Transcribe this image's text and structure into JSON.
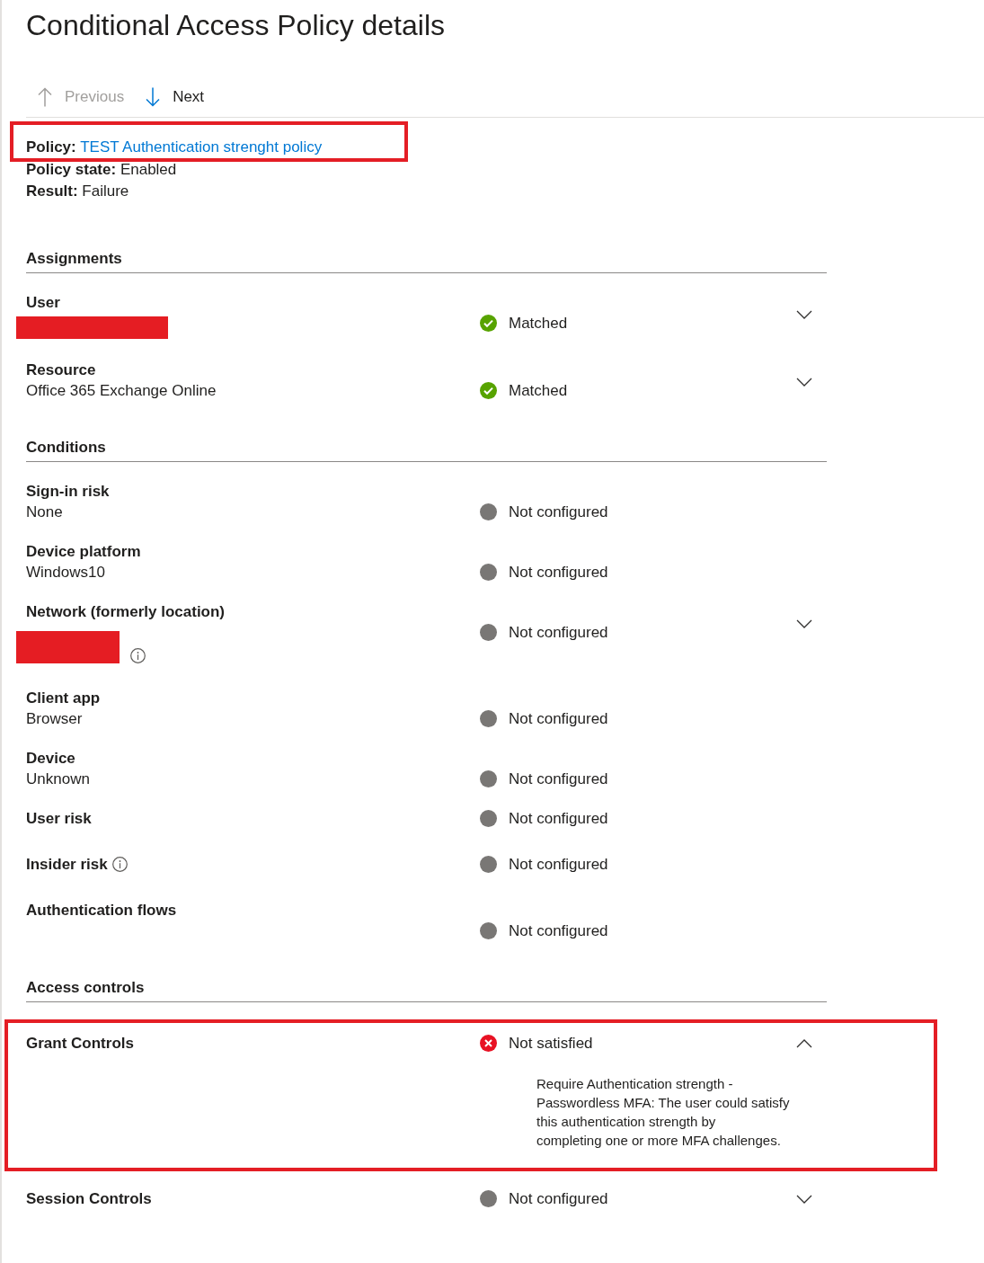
{
  "title": "Conditional Access Policy details",
  "navigation": [
    {
      "kind": "up",
      "label": "Previous",
      "disabled": true
    },
    {
      "kind": "down",
      "label": "Next",
      "disabled": false
    }
  ],
  "policy": [
    {
      "kind": "link",
      "label": "Policy:",
      "value": "TEST Authentication strenght policy",
      "highlighted": true
    },
    {
      "kind": "text",
      "label": "Policy state:",
      "value": "Enabled",
      "highlighted": false
    },
    {
      "kind": "text",
      "label": "Result:",
      "value": "Failure",
      "highlighted": false
    }
  ],
  "sections": [
    {
      "title": "Assignments",
      "rows": [
        {
          "kind": "stacked",
          "label": "User",
          "redacted": true,
          "status": {
            "kind": "matched",
            "text": "Matched"
          },
          "expanded": false,
          "highlighted": false
        },
        {
          "kind": "stacked",
          "label": "Resource",
          "value": "Office 365 Exchange Online",
          "status": {
            "kind": "matched",
            "text": "Matched"
          },
          "expanded": false,
          "highlighted": false
        }
      ]
    },
    {
      "title": "Conditions",
      "rows": [
        {
          "kind": "stacked",
          "label": "Sign-in risk",
          "value": "None",
          "status": {
            "kind": "not_configured",
            "text": "Not configured"
          },
          "highlighted": false
        },
        {
          "kind": "stacked",
          "label": "Device platform",
          "value": "Windows10",
          "status": {
            "kind": "not_configured",
            "text": "Not configured"
          },
          "highlighted": false
        },
        {
          "kind": "stacked",
          "label": "Network (formerly location)",
          "redacted": true,
          "value_info": true,
          "status": {
            "kind": "not_configured",
            "text": "Not configured"
          },
          "expanded": false,
          "highlighted": false
        },
        {
          "kind": "stacked",
          "label": "Client app",
          "value": "Browser",
          "status": {
            "kind": "not_configured",
            "text": "Not configured"
          },
          "highlighted": false
        },
        {
          "kind": "stacked",
          "label": "Device",
          "value": "Unknown",
          "status": {
            "kind": "not_configured",
            "text": "Not configured"
          },
          "highlighted": false
        },
        {
          "kind": "inline",
          "label": "User risk",
          "status": {
            "kind": "not_configured",
            "text": "Not configured"
          },
          "highlighted": false
        },
        {
          "kind": "inline",
          "label": "Insider risk",
          "label_info": true,
          "status": {
            "kind": "not_configured",
            "text": "Not configured"
          },
          "highlighted": false
        },
        {
          "kind": "stacked",
          "label": "Authentication flows",
          "status": {
            "kind": "not_configured",
            "text": "Not configured"
          },
          "highlighted": false
        }
      ]
    },
    {
      "title": "Access controls",
      "rows": [
        {
          "kind": "inline",
          "label": "Grant Controls",
          "status": {
            "kind": "not_satisfied",
            "text": "Not satisfied"
          },
          "expanded": true,
          "detail_lines": [
            "Require Authentication strength -",
            "Passwordless MFA: The user could satisfy",
            "this authentication strength by",
            "completing one or more MFA challenges."
          ],
          "highlighted": true
        },
        {
          "kind": "inline",
          "label": "Session Controls",
          "status": {
            "kind": "not_configured",
            "text": "Not configured"
          },
          "expanded": false,
          "highlighted": false
        }
      ]
    }
  ]
}
